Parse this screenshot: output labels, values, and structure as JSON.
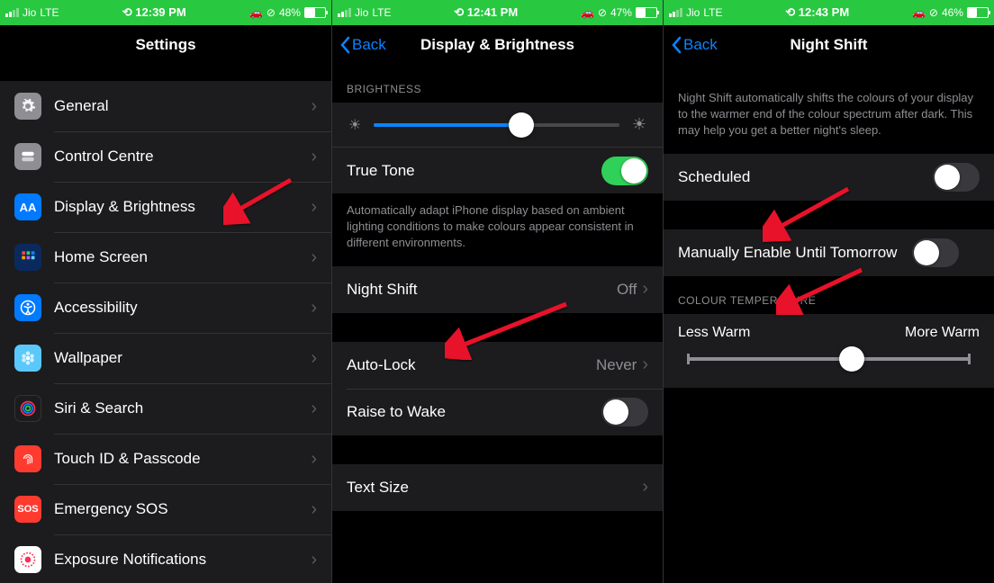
{
  "p1": {
    "status": {
      "carrier": "Jio",
      "net": "LTE",
      "time": "12:39 PM",
      "batt": "48%",
      "batt_pct": 48
    },
    "title": "Settings",
    "items": [
      {
        "label": "General"
      },
      {
        "label": "Control Centre"
      },
      {
        "label": "Display & Brightness"
      },
      {
        "label": "Home Screen"
      },
      {
        "label": "Accessibility"
      },
      {
        "label": "Wallpaper"
      },
      {
        "label": "Siri & Search"
      },
      {
        "label": "Touch ID & Passcode"
      },
      {
        "label": "Emergency SOS"
      },
      {
        "label": "Exposure Notifications"
      }
    ]
  },
  "p2": {
    "status": {
      "carrier": "Jio",
      "net": "LTE",
      "time": "12:41 PM",
      "batt": "47%",
      "batt_pct": 47
    },
    "back": "Back",
    "title": "Display & Brightness",
    "group_brightness": "BRIGHTNESS",
    "brightness_pct": 60,
    "true_tone": {
      "label": "True Tone",
      "on": true
    },
    "note": "Automatically adapt iPhone display based on ambient lighting conditions to make colours appear consistent in different environments.",
    "night_shift": {
      "label": "Night Shift",
      "value": "Off"
    },
    "auto_lock": {
      "label": "Auto-Lock",
      "value": "Never"
    },
    "raise": {
      "label": "Raise to Wake",
      "on": false
    },
    "text_size": {
      "label": "Text Size"
    }
  },
  "p3": {
    "status": {
      "carrier": "Jio",
      "net": "LTE",
      "time": "12:43 PM",
      "batt": "46%",
      "batt_pct": 46
    },
    "back": "Back",
    "title": "Night Shift",
    "intro": "Night Shift automatically shifts the colours of your display to the warmer end of the colour spectrum after dark. This may help you get a better night's sleep.",
    "scheduled": {
      "label": "Scheduled",
      "on": false
    },
    "manual": {
      "label": "Manually Enable Until Tomorrow",
      "on": false
    },
    "group_temp": "COLOUR TEMPERATURE",
    "less": "Less Warm",
    "more": "More Warm",
    "temp_pct": 58
  }
}
